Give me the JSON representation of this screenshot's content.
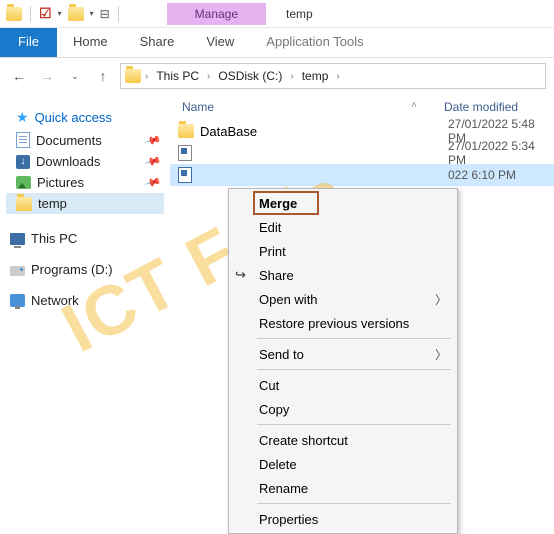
{
  "titlebar": {
    "manage_label": "Manage",
    "window_title": "temp"
  },
  "ribbon": {
    "file": "File",
    "home": "Home",
    "share": "Share",
    "view": "View",
    "app_tools": "Application Tools"
  },
  "breadcrumb": {
    "p0": "This PC",
    "p1": "OSDisk (C:)",
    "p2": "temp"
  },
  "columns": {
    "name": "Name",
    "date": "Date modified"
  },
  "sidebar": {
    "quick": "Quick access",
    "documents": "Documents",
    "downloads": "Downloads",
    "pictures": "Pictures",
    "temp": "temp",
    "thispc": "This PC",
    "programs": "Programs (D:)",
    "network": "Network"
  },
  "files": [
    {
      "name": "DataBase",
      "date": "27/01/2022 5:48 PM"
    },
    {
      "name": "",
      "date": "27/01/2022 5:34 PM"
    },
    {
      "name": "",
      "date": "022 6:10 PM"
    }
  ],
  "context_menu": {
    "merge": "Merge",
    "edit": "Edit",
    "print": "Print",
    "share": "Share",
    "open_with": "Open with",
    "restore": "Restore previous versions",
    "send_to": "Send to",
    "cut": "Cut",
    "copy": "Copy",
    "shortcut": "Create shortcut",
    "delete": "Delete",
    "rename": "Rename",
    "properties": "Properties"
  },
  "watermark": "ICT Fella"
}
